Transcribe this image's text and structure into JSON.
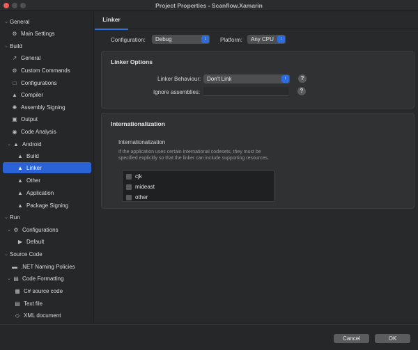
{
  "window": {
    "title": "Project Properties - Scanflow.Xamarin"
  },
  "sidebar": {
    "items": [
      {
        "label": "General",
        "icon": "chevron-down-icon",
        "level": 0,
        "type": "group"
      },
      {
        "label": "Main Settings",
        "icon": "gear-icon",
        "level": 1
      },
      {
        "label": "Build",
        "icon": "chevron-down-icon",
        "level": 0,
        "type": "group"
      },
      {
        "label": "General",
        "icon": "hammer-icon",
        "level": 1
      },
      {
        "label": "Custom Commands",
        "icon": "gear-icon",
        "level": 1
      },
      {
        "label": "Configurations",
        "icon": "window-icon",
        "level": 1
      },
      {
        "label": "Compiler",
        "icon": "compiler-icon",
        "level": 1
      },
      {
        "label": "Assembly Signing",
        "icon": "seal-icon",
        "level": 1
      },
      {
        "label": "Output",
        "icon": "output-icon",
        "level": 1
      },
      {
        "label": "Code Analysis",
        "icon": "target-icon",
        "level": 1
      },
      {
        "label": "Android",
        "icon": "android-icon",
        "level": 1,
        "type": "group"
      },
      {
        "label": "Build",
        "icon": "android-icon",
        "level": 2
      },
      {
        "label": "Linker",
        "icon": "android-icon",
        "level": 2,
        "selected": true
      },
      {
        "label": "Other",
        "icon": "android-icon",
        "level": 2
      },
      {
        "label": "Application",
        "icon": "android-icon",
        "level": 2
      },
      {
        "label": "Package Signing",
        "icon": "android-icon",
        "level": 2
      },
      {
        "label": "Run",
        "icon": "chevron-down-icon",
        "level": 0,
        "type": "group"
      },
      {
        "label": "Configurations",
        "icon": "gear-icon",
        "level": 1,
        "type": "group"
      },
      {
        "label": "Default",
        "icon": "play-icon",
        "level": 2
      },
      {
        "label": "Source Code",
        "icon": "chevron-down-icon",
        "level": 0,
        "type": "group"
      },
      {
        "label": ".NET Naming Policies",
        "icon": "naming-icon",
        "level": 1
      },
      {
        "label": "Code Formatting",
        "icon": "format-icon",
        "level": 1,
        "type": "group"
      },
      {
        "label": "C# source code",
        "icon": "csharp-file-icon",
        "level": 2
      },
      {
        "label": "Text file",
        "icon": "text-file-icon",
        "level": 2
      },
      {
        "label": "XML document",
        "icon": "xml-file-icon",
        "level": 2
      }
    ]
  },
  "main": {
    "tabs": [
      {
        "label": "Linker",
        "active": true
      }
    ],
    "configuration": {
      "label": "Configuration:",
      "value": "Debug"
    },
    "platform": {
      "label": "Platform:",
      "value": "Any CPU"
    },
    "linker_options": {
      "title": "Linker Options",
      "behaviour_label": "Linker Behaviour:",
      "behaviour_value": "Don't Link",
      "ignore_label": "Ignore assemblies:",
      "ignore_value": "",
      "help_glyph": "?"
    },
    "internationalization": {
      "title": "Internationalization",
      "subtitle": "Internationalization",
      "description": "If the application uses certain international codesets, they must be specified explicitly so that the linker can include supporting resources.",
      "options": [
        {
          "label": "cjk",
          "checked": false
        },
        {
          "label": "mideast",
          "checked": false
        },
        {
          "label": "other",
          "checked": false
        }
      ]
    }
  },
  "footer": {
    "cancel_label": "Cancel",
    "ok_label": "OK"
  },
  "colors": {
    "accent": "#2b62d6",
    "background": "#262729",
    "panel": "#303133"
  }
}
